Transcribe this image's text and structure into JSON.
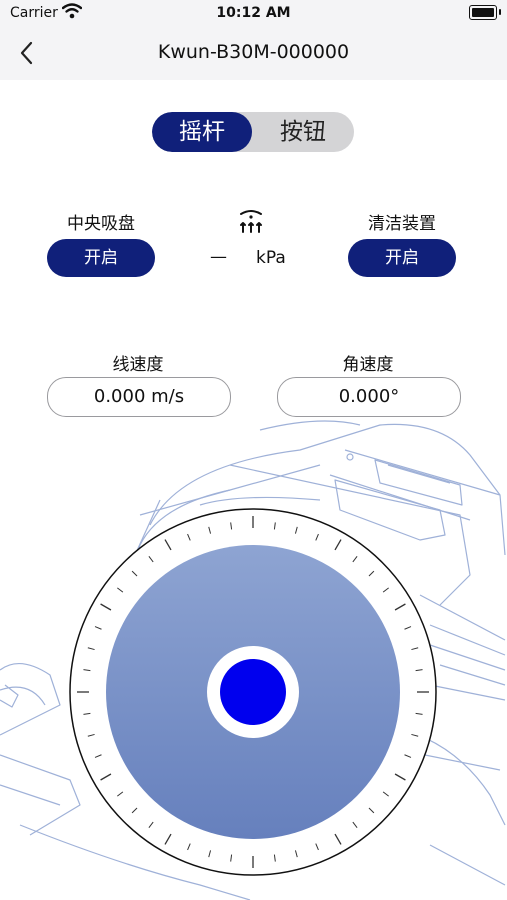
{
  "status_bar": {
    "carrier": "Carrier",
    "time": "10:12 AM",
    "icons": [
      "wifi-icon",
      "battery-icon"
    ]
  },
  "nav": {
    "title": "Kwun-B30M-000000",
    "back_icon": "chevron-left-icon"
  },
  "mode_switch": {
    "active": "摇杆",
    "inactive": "按钮"
  },
  "suction": {
    "label": "中央吸盘",
    "button": "开启"
  },
  "pressure": {
    "icon": "pressure-icon",
    "value": "—",
    "unit": "kPa"
  },
  "cleaning": {
    "label": "清洁装置",
    "button": "开启"
  },
  "linear_speed": {
    "label": "线速度",
    "value": "0.000 m/s"
  },
  "angular_speed": {
    "label": "角速度",
    "value": "0.000°"
  },
  "colors": {
    "accent": "#10207a",
    "joystick_knob": "#0000ee",
    "joystick_pad_top": "#8ea4d2",
    "joystick_pad_bottom": "#6680bd"
  }
}
